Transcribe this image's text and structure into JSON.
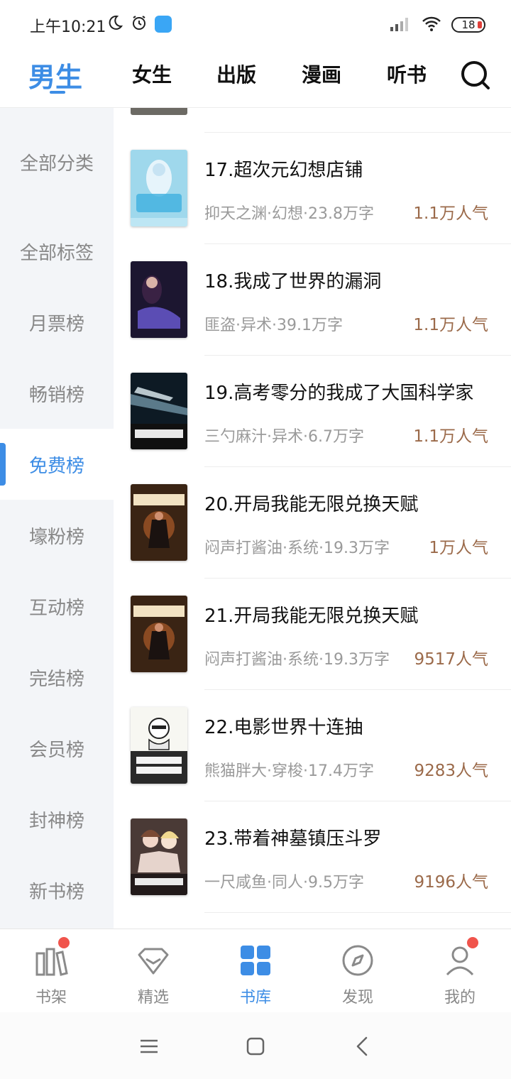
{
  "status_bar": {
    "time": "上午10:21",
    "battery": "18"
  },
  "top_tabs": [
    {
      "label": "男生",
      "active": true
    },
    {
      "label": "女生",
      "active": false
    },
    {
      "label": "出版",
      "active": false
    },
    {
      "label": "漫画",
      "active": false
    },
    {
      "label": "听书",
      "active": false
    }
  ],
  "search_icon": "search-icon",
  "sidebar": {
    "items": [
      {
        "label": "全部分类"
      },
      {
        "label": "全部标签"
      },
      {
        "label": "月票榜"
      },
      {
        "label": "畅销榜"
      },
      {
        "label": "免费榜",
        "active": true
      },
      {
        "label": "壕粉榜"
      },
      {
        "label": "互动榜"
      },
      {
        "label": "完结榜"
      },
      {
        "label": "会员榜"
      },
      {
        "label": "封神榜"
      },
      {
        "label": "新书榜"
      }
    ]
  },
  "books": [
    {
      "title": "17.超次元幻想店铺",
      "meta": "抑天之渊·幻想·23.8万字",
      "popularity": "1.1万人气"
    },
    {
      "title": "18.我成了世界的漏洞",
      "meta": "匪盗·异术·39.1万字",
      "popularity": "1.1万人气"
    },
    {
      "title": "19.高考零分的我成了大国科学家",
      "meta": "三勺麻汁·异术·6.7万字",
      "popularity": "1.1万人气"
    },
    {
      "title": "20.开局我能无限兑换天赋",
      "meta": "闷声打酱油·系统·19.3万字",
      "popularity": "1万人气"
    },
    {
      "title": "21.开局我能无限兑换天赋",
      "meta": "闷声打酱油·系统·19.3万字",
      "popularity": "9517人气"
    },
    {
      "title": "22.电影世界十连抽",
      "meta": "熊猫胖大·穿梭·17.4万字",
      "popularity": "9283人气"
    },
    {
      "title": "23.带着神墓镇压斗罗",
      "meta": "一尺咸鱼·同人·9.5万字",
      "popularity": "9196人气"
    }
  ],
  "bottom_nav": [
    {
      "label": "书架",
      "icon": "bookshelf-icon",
      "badge": true
    },
    {
      "label": "精选",
      "icon": "diamond-icon",
      "badge": false
    },
    {
      "label": "书库",
      "icon": "library-grid-icon",
      "active": true,
      "badge": false
    },
    {
      "label": "发现",
      "icon": "compass-icon",
      "badge": false
    },
    {
      "label": "我的",
      "icon": "profile-icon",
      "badge": true
    }
  ],
  "colors": {
    "accent": "#3d8de5",
    "popularity": "#9b6a4a",
    "badge": "#f0544c"
  }
}
